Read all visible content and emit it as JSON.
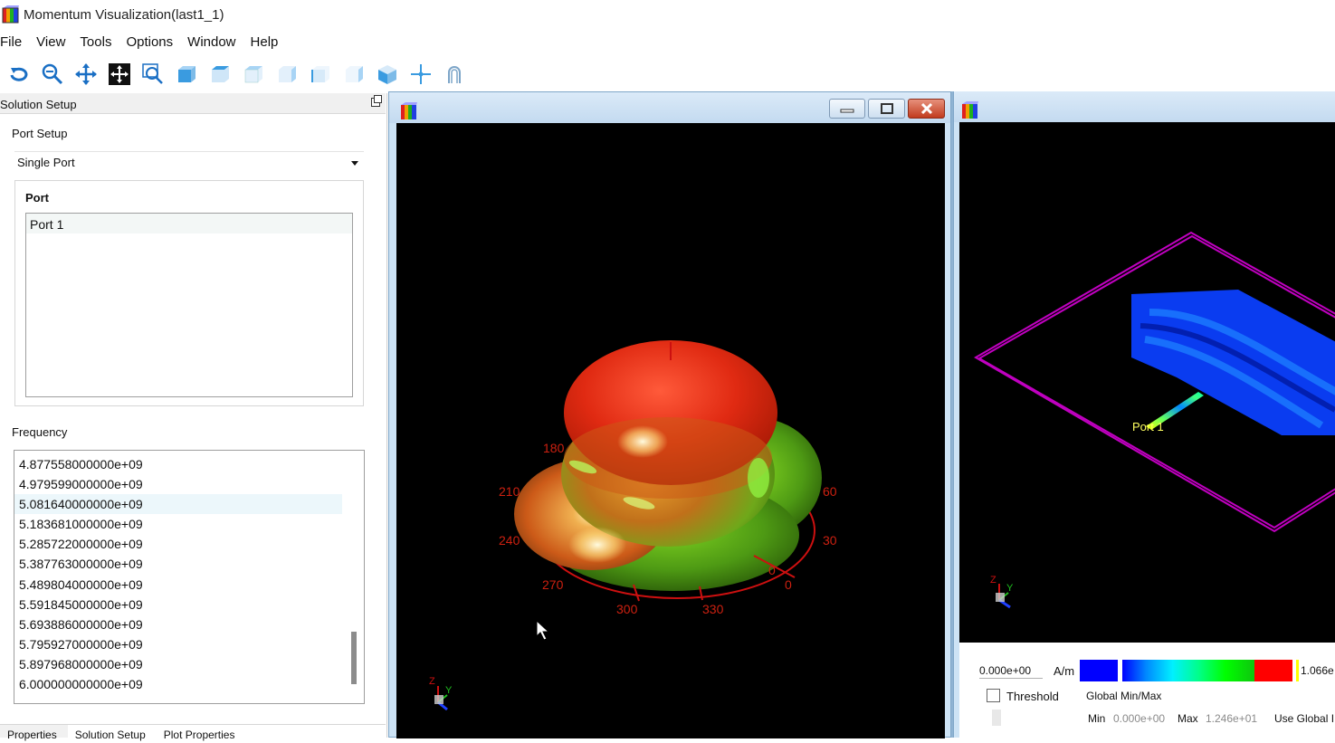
{
  "app": {
    "title": "Momentum Visualization(last1_1)"
  },
  "menu": [
    "File",
    "View",
    "Tools",
    "Options",
    "Window",
    "Help"
  ],
  "toolbar": {
    "icons": [
      "rotate-icon",
      "zoom-icon",
      "pan-icon",
      "fit-icon",
      "zoom-box-icon",
      "view-front-icon",
      "view-back-icon",
      "view-top-icon",
      "view-bottom-icon",
      "view-left-icon",
      "view-right-icon",
      "view-iso-icon",
      "axes-icon",
      "magnet-icon"
    ]
  },
  "left_panel": {
    "title": "Solution Setup",
    "port_setup_label": "Port Setup",
    "port_mode": "Single Port",
    "port_group_label": "Port",
    "ports": [
      "Port 1"
    ],
    "frequency_label": "Frequency",
    "frequencies": [
      "4.877558000000e+09",
      "4.979599000000e+09",
      "5.081640000000e+09",
      "5.183681000000e+09",
      "5.285722000000e+09",
      "5.387763000000e+09",
      "5.489804000000e+09",
      "5.591845000000e+09",
      "5.693886000000e+09",
      "5.795927000000e+09",
      "5.897968000000e+09",
      "6.000000000000e+09"
    ],
    "selected_frequency_index": 2,
    "tabs": [
      "Properties",
      "Solution Setup",
      "Plot Properties"
    ]
  },
  "plot3d": {
    "angle_labels": [
      "180",
      "210",
      "240",
      "270",
      "300",
      "330",
      "0",
      "30",
      "60",
      "0"
    ],
    "axis_labels": [
      "Z",
      "Y"
    ],
    "colors": {
      "pattern_top": "#e22a10",
      "pattern_mid": "#8fc21a",
      "ring": "#d01010"
    }
  },
  "plot2d": {
    "port_label": "Port 1",
    "axis_labels": [
      "Z",
      "Y"
    ],
    "legend": {
      "min_value": "0.000e+00",
      "unit": "A/m",
      "max_value": "1.066e",
      "threshold_label": "Threshold",
      "global_minmax_label": "Global Min/Max",
      "min_label": "Min",
      "min_global": "0.000e+00",
      "max_label": "Max",
      "max_global": "1.246e+01",
      "use_global_label": "Use Global I"
    },
    "colors": {
      "substrate_outline": "#c000c0",
      "current_low": "#0000ff",
      "current_high": "#ff0000"
    }
  }
}
